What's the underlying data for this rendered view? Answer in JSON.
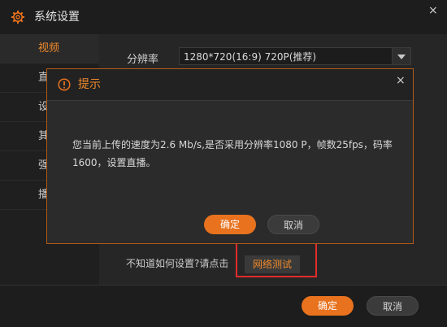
{
  "window": {
    "title": "系统设置",
    "close_glyph": "×"
  },
  "sidebar": {
    "items": [
      {
        "label": "视频"
      },
      {
        "label": "直"
      },
      {
        "label": "设"
      },
      {
        "label": "其"
      },
      {
        "label": "强"
      },
      {
        "label": "播"
      }
    ]
  },
  "video": {
    "resolution_label": "分辨率",
    "resolution_value": "1280*720(16:9) 720P(推荐)"
  },
  "hint": {
    "text": "不知道如何设置?请点击",
    "net_test_label": "网络测试"
  },
  "footer": {
    "ok_label": "确定",
    "cancel_label": "取消"
  },
  "dialog": {
    "title": "提示",
    "close_glyph": "×",
    "message_line1": "您当前上传的速度为2.6 Mb/s,是否采用分辨率1080 P，帧数25fps，码率",
    "message_line2": "1600，设置直播。",
    "ok_label": "确定",
    "cancel_label": "取消"
  },
  "colors": {
    "accent": "#e8721e",
    "highlight": "#e22b2b"
  }
}
